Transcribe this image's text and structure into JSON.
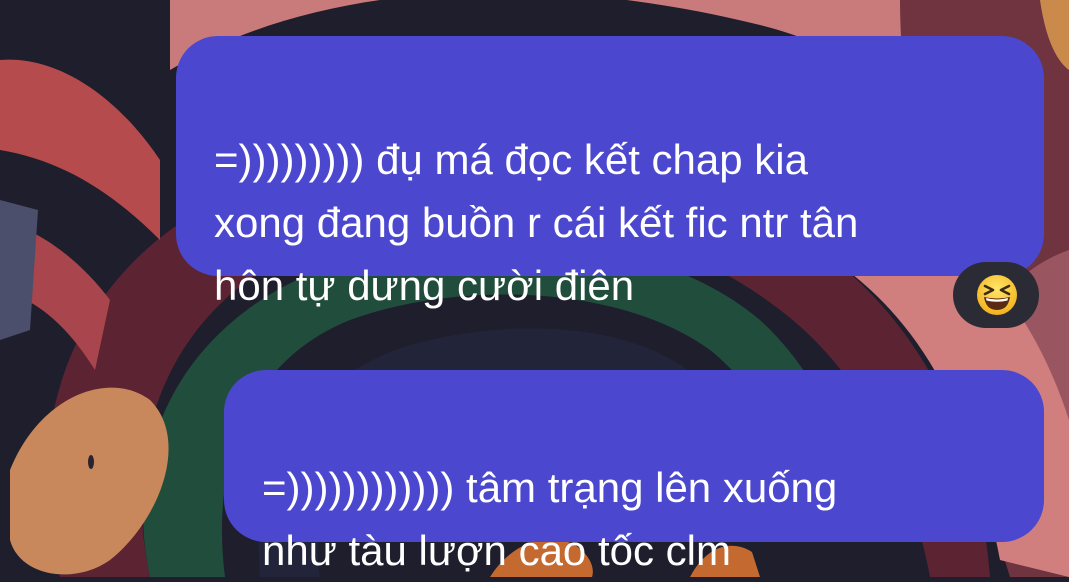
{
  "conversation": {
    "messages": [
      {
        "text": "=))))))))) đụ má đọc kết chap kia\nxong đang buồn r cái kết fic ntr tân\nhôn tự dưng cười điên",
        "reaction": "grinning-squinting-face-emoji"
      },
      {
        "text": "=)))))))))))) tâm trạng lên xuống\nnhư tàu lượn cao tốc clm"
      }
    ]
  },
  "colors": {
    "bubble": "#4b48cf",
    "text": "#ffffff",
    "reaction_pill": "#2b2b36"
  }
}
